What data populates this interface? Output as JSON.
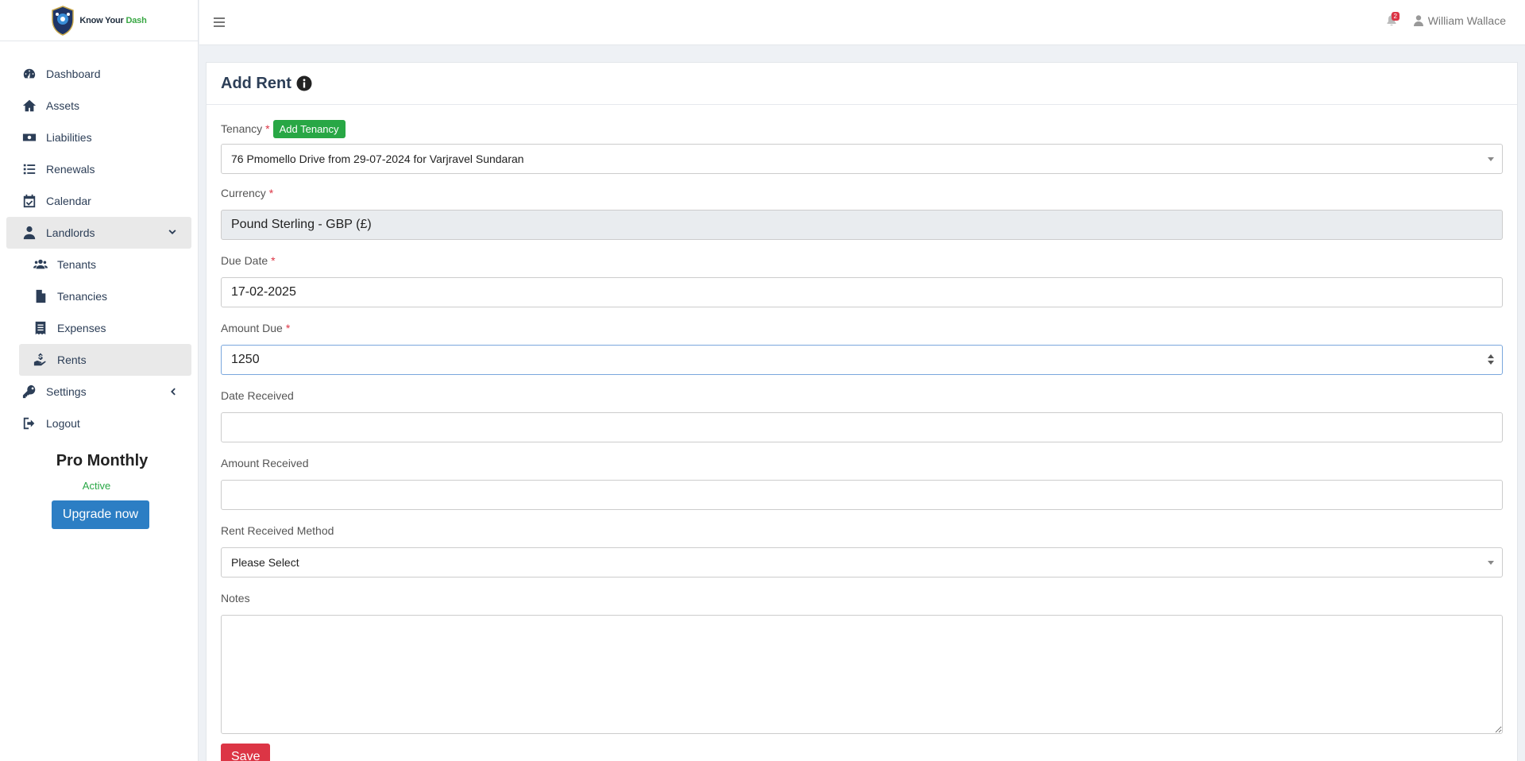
{
  "brand": {
    "name_part1": "Know Your ",
    "name_part2": "Dash",
    "accent_color": "#3aa845"
  },
  "sidebar": {
    "items": [
      {
        "label": "Dashboard",
        "icon": "gauge-icon"
      },
      {
        "label": "Assets",
        "icon": "home-icon"
      },
      {
        "label": "Liabilities",
        "icon": "money-bill-icon"
      },
      {
        "label": "Renewals",
        "icon": "list-icon"
      },
      {
        "label": "Calendar",
        "icon": "calendar-check-icon"
      },
      {
        "label": "Landlords",
        "icon": "user-tie-icon",
        "expanded": true
      },
      {
        "label": "Settings",
        "icon": "key-icon"
      },
      {
        "label": "Logout",
        "icon": "sign-out-icon"
      }
    ],
    "sub_items": [
      {
        "label": "Tenants",
        "icon": "users-icon"
      },
      {
        "label": "Tenancies",
        "icon": "file-contract-icon"
      },
      {
        "label": "Expenses",
        "icon": "receipt-icon"
      },
      {
        "label": "Rents",
        "icon": "hand-holding-dollar-icon",
        "active": true
      }
    ],
    "plan": {
      "name": "Pro Monthly",
      "status": "Active",
      "upgrade_label": "Upgrade now"
    }
  },
  "topbar": {
    "notification_count": "2",
    "user_name": "William Wallace"
  },
  "page": {
    "title": "Add Rent",
    "fields": {
      "tenancy": {
        "label": "Tenancy",
        "add_label": "Add Tenancy",
        "value": "76 Pmomello Drive from 29-07-2024 for Varjravel Sundaran"
      },
      "currency": {
        "label": "Currency",
        "value": "Pound Sterling - GBP (£)"
      },
      "due_date": {
        "label": "Due Date",
        "value": "17-02-2025"
      },
      "amount_due": {
        "label": "Amount Due",
        "value": "1250"
      },
      "date_received": {
        "label": "Date Received",
        "value": ""
      },
      "amount_received": {
        "label": "Amount Received",
        "value": ""
      },
      "method": {
        "label": "Rent Received Method",
        "value": "Please Select"
      },
      "notes": {
        "label": "Notes",
        "value": ""
      }
    },
    "save_label": "Save",
    "required_mark": "*"
  },
  "colors": {
    "primary": "#2c7ec4",
    "danger": "#dc3545",
    "success": "#28a745",
    "nav_text": "#2c3e57"
  }
}
